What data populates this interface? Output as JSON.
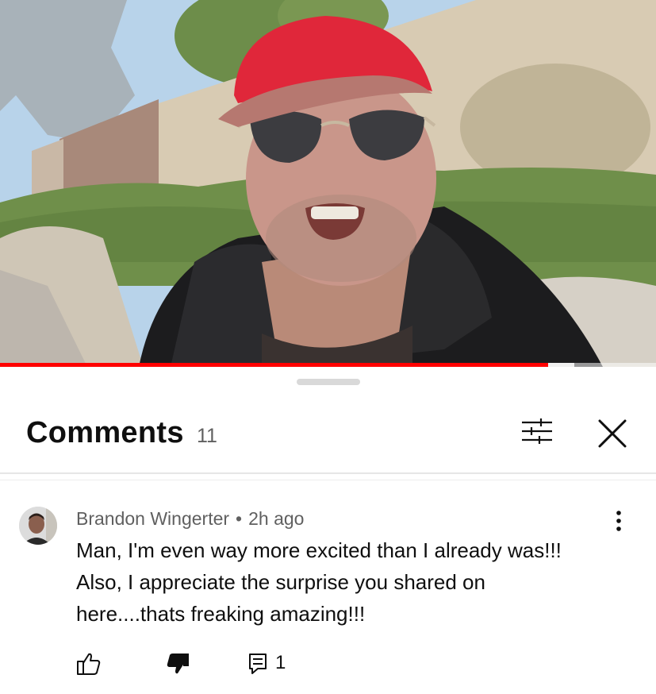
{
  "video": {
    "progress_percent": 83.5,
    "buffered_percent": 4
  },
  "comments_panel": {
    "title": "Comments",
    "count": "11",
    "icons": {
      "filter": "sort-filter-icon",
      "close": "close-icon"
    }
  },
  "comment": {
    "author": "Brandon Wingerter",
    "separator": "•",
    "time": "2h ago",
    "lines": [
      "Man, I'm even way more excited than I already was!!!",
      "Also, I appreciate the surprise you shared on",
      "here....thats freaking amazing!!!"
    ],
    "reply_count": "1",
    "icons": {
      "like": "thumbs-up-icon",
      "dislike": "thumbs-down-icon",
      "reply": "reply-comment-icon",
      "more": "more-vertical-icon"
    }
  },
  "colors": {
    "progress": "#ff0000",
    "text_primary": "#0f0f0f",
    "text_secondary": "#606060"
  }
}
